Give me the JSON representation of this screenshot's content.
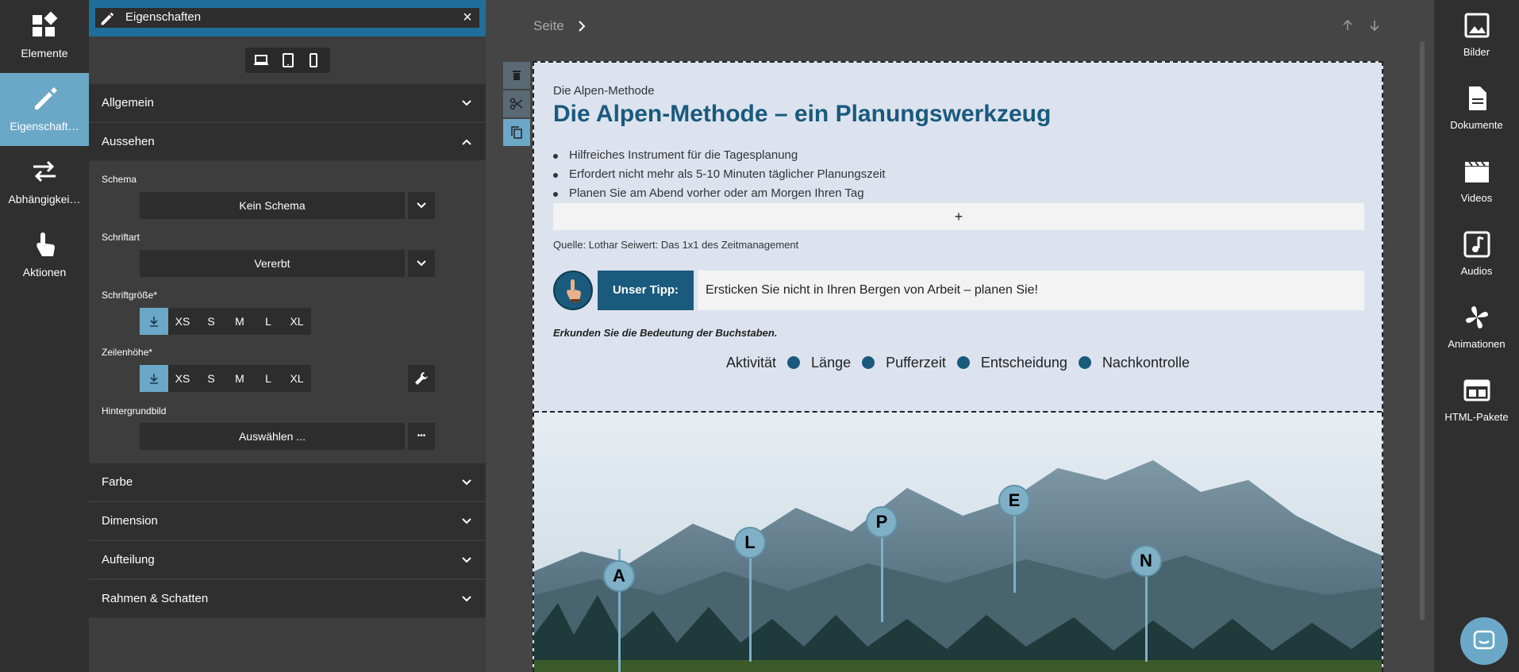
{
  "left_nav": [
    {
      "label": "Elemente",
      "icon": "widgets-icon"
    },
    {
      "label": "Eigenschaft…",
      "icon": "pencil-icon",
      "active": true
    },
    {
      "label": "Abhängigkei…",
      "icon": "swap-icon"
    },
    {
      "label": "Aktionen",
      "icon": "touch-icon"
    }
  ],
  "panel": {
    "title": "Eigenschaften",
    "close": "×",
    "sections_top": [
      {
        "label": "Allgemein",
        "expanded": false
      },
      {
        "label": "Aussehen",
        "expanded": true
      }
    ],
    "schema": {
      "label": "Schema",
      "value": "Kein Schema"
    },
    "schriftart": {
      "label": "Schriftart",
      "value": "Vererbt"
    },
    "schriftgroesse": {
      "label": "Schriftgröße*",
      "options": [
        "XS",
        "S",
        "M",
        "L",
        "XL"
      ]
    },
    "zeilenhoehe": {
      "label": "Zeilenhöhe*",
      "options": [
        "XS",
        "S",
        "M",
        "L",
        "XL"
      ]
    },
    "hintergrundbild": {
      "label": "Hintergrundbild",
      "value": "Auswählen ...",
      "more": "•••"
    },
    "sections_bottom": [
      {
        "label": "Farbe"
      },
      {
        "label": "Dimension"
      },
      {
        "label": "Aufteilung"
      },
      {
        "label": "Rahmen & Schatten"
      }
    ]
  },
  "canvas": {
    "breadcrumb": "Seite",
    "kicker": "Die Alpen-Methode",
    "heading": "Die Alpen-Methode – ein Planungswerkzeug",
    "bullets": [
      "Hilfreiches Instrument für die Tagesplanung",
      "Erfordert nicht mehr als 5-10 Minuten täglicher Planungszeit",
      "Planen Sie am Abend vorher oder am Morgen Ihren Tag"
    ],
    "add": "+",
    "source": "Quelle: Lothar Seiwert: Das 1x1 des Zeitmanagement",
    "tip_label": "Unser Tipp:",
    "tip_text": "Ersticken Sie nicht in Ihren Bergen von Arbeit – planen Sie!",
    "explore": "Erkunden Sie die Bedeutung der Buchstaben.",
    "legend": [
      "Aktivität",
      "Länge",
      "Pufferzeit",
      "Entscheidung",
      "Nachkontrolle"
    ],
    "markers": [
      "A",
      "L",
      "P",
      "E",
      "N"
    ]
  },
  "right_nav": [
    {
      "label": "Bilder",
      "icon": "image-icon"
    },
    {
      "label": "Dokumente",
      "icon": "document-icon"
    },
    {
      "label": "Videos",
      "icon": "video-icon"
    },
    {
      "label": "Audios",
      "icon": "audio-icon"
    },
    {
      "label": "Animationen",
      "icon": "animation-icon"
    },
    {
      "label": "HTML-Pakete",
      "icon": "html-package-icon"
    }
  ],
  "colors": {
    "accent": "#6ba8c7",
    "header": "#1f6e9b",
    "heading": "#1a5a7c"
  }
}
